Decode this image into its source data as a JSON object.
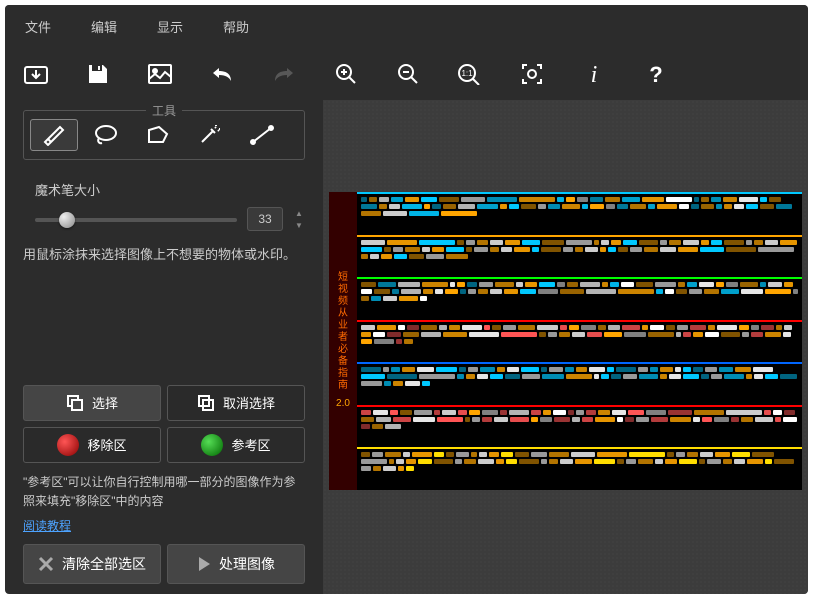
{
  "menu": {
    "file": "文件",
    "edit": "编辑",
    "view": "显示",
    "help": "帮助"
  },
  "tools": {
    "group_label": "工具",
    "brush_size_label": "魔术笔大小",
    "brush_size_value": "33",
    "hint": "用鼠标涂抹来选择图像上不想要的物体或水印。"
  },
  "buttons": {
    "select": "选择",
    "deselect": "取消选择",
    "remove_zone": "移除区",
    "reference_zone": "参考区",
    "clear_all": "清除全部选区",
    "process": "处理图像"
  },
  "text": {
    "reference_note": "\"参考区\"可以让你自行控制用哪一部分的图像作为参照来填充\"移除区\"中的内容",
    "tutorial_link": "阅读教程"
  },
  "preview": {
    "side_text": "短视频从业者必备指南",
    "side_version": "2.0",
    "rows": [
      {
        "border": "#00c8ff",
        "colors": [
          "#00c8ff",
          "#ffa500",
          "#fff",
          "#00c8ff",
          "#ffa500"
        ]
      },
      {
        "border": "#ffa500",
        "colors": [
          "#ffa500",
          "#fff",
          "#ffa500",
          "#fff",
          "#ffa500",
          "#00c8ff"
        ]
      },
      {
        "border": "#00ff00",
        "colors": [
          "#fff",
          "#ffa500",
          "#00c8ff",
          "#fff",
          "#ffa500"
        ]
      },
      {
        "border": "#ff0000",
        "colors": [
          "#ffa500",
          "#fff",
          "#ff5555",
          "#ffa500",
          "#fff"
        ]
      },
      {
        "border": "#0066ff",
        "colors": [
          "#00c8ff",
          "#fff",
          "#00c8ff",
          "#ffa500",
          "#fff",
          "#00c8ff"
        ]
      },
      {
        "border": "#ff0000",
        "colors": [
          "#ff5555",
          "#fff",
          "#ff5555",
          "#ffa500",
          "#fff"
        ]
      },
      {
        "border": "#ffdd00",
        "colors": [
          "#ffa500",
          "#fff",
          "#ffa500",
          "#fff",
          "#ffa500",
          "#ffdd00"
        ]
      }
    ]
  }
}
